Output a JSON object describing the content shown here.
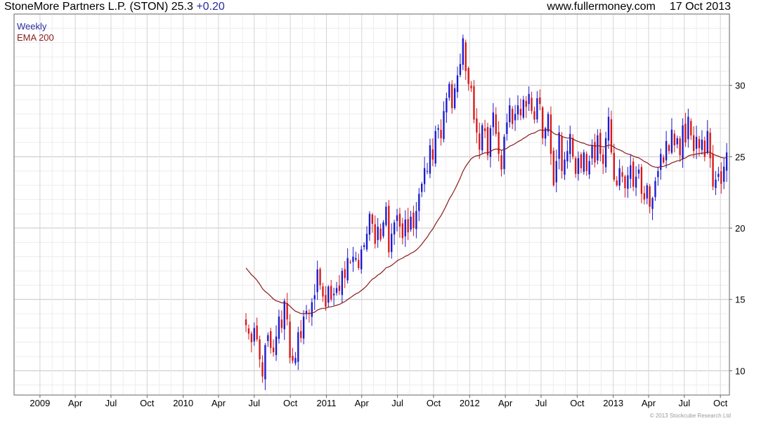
{
  "header": {
    "title": "StoneMore Partners L.P. (STON) 25.3",
    "change": "+0.20",
    "site": "www.fullermoney.com",
    "date": "17 Oct 2013"
  },
  "legend": {
    "period": "Weekly",
    "indicator": "EMA 200"
  },
  "copyright": "© 2013 Stockcube Research Ltd",
  "colors": {
    "up": "#1a1ad0",
    "down": "#d81818",
    "ema": "#8b1a1a",
    "grid": "#d8d8d8",
    "frame": "#666666"
  },
  "chart_data": {
    "type": "candlestick",
    "frequency": "weekly",
    "ylim": [
      8.3,
      35.0
    ],
    "yticks": [
      10,
      15,
      20,
      25,
      30
    ],
    "xticks": [
      {
        "label": "2009",
        "date": "2009-01-01"
      },
      {
        "label": "Apr",
        "date": "2009-04-01"
      },
      {
        "label": "Jul",
        "date": "2009-07-01"
      },
      {
        "label": "Oct",
        "date": "2009-10-01"
      },
      {
        "label": "2010",
        "date": "2010-01-01"
      },
      {
        "label": "Apr",
        "date": "2010-04-01"
      },
      {
        "label": "Jul",
        "date": "2010-07-01"
      },
      {
        "label": "Oct",
        "date": "2010-10-01"
      },
      {
        "label": "2011",
        "date": "2011-01-01"
      },
      {
        "label": "Apr",
        "date": "2011-04-01"
      },
      {
        "label": "Jul",
        "date": "2011-07-01"
      },
      {
        "label": "Oct",
        "date": "2011-10-01"
      },
      {
        "label": "2012",
        "date": "2012-01-01"
      },
      {
        "label": "Apr",
        "date": "2012-04-01"
      },
      {
        "label": "Jul",
        "date": "2012-07-01"
      },
      {
        "label": "Oct",
        "date": "2012-10-01"
      },
      {
        "label": "2013",
        "date": "2013-01-01"
      },
      {
        "label": "Apr",
        "date": "2013-04-01"
      },
      {
        "label": "Jul",
        "date": "2013-07-01"
      },
      {
        "label": "Oct",
        "date": "2013-10-01"
      }
    ],
    "x_range": [
      "2008-10-27",
      "2013-10-24"
    ],
    "close_weekly": [
      13.2,
      12.6,
      12.0,
      13.0,
      12.2,
      10.8,
      9.6,
      11.8,
      12.5,
      11.6,
      11.3,
      12.4,
      13.8,
      13.0,
      14.9,
      13.6,
      10.9,
      10.7,
      10.9,
      12.7,
      12.3,
      13.8,
      14.2,
      14.0,
      14.8,
      15.3,
      17.1,
      16.0,
      15.2,
      14.5,
      15.9,
      15.0,
      15.4,
      15.8,
      15.6,
      17.0,
      16.5,
      17.9,
      17.6,
      18.0,
      17.9,
      17.2,
      18.5,
      18.8,
      19.6,
      21.0,
      20.3,
      18.9,
      20.1,
      19.2,
      20.4,
      21.5,
      18.3,
      19.6,
      20.4,
      20.9,
      20.1,
      19.3,
      20.6,
      19.7,
      20.8,
      20.0,
      21.2,
      22.4,
      23.1,
      24.2,
      24.0,
      25.8,
      24.8,
      26.8,
      27.0,
      26.3,
      28.2,
      29.1,
      30.1,
      28.4,
      29.8,
      30.7,
      31.5,
      33.3,
      31.0,
      30.1,
      29.8,
      27.6,
      26.7,
      25.5,
      27.2,
      26.8,
      25.1,
      27.0,
      28.1,
      26.6,
      25.2,
      24.1,
      26.4,
      27.4,
      28.6,
      27.3,
      28.0,
      28.6,
      27.9,
      29.0,
      28.5,
      29.4,
      28.2,
      27.6,
      29.1,
      28.7,
      26.3,
      27.0,
      28.0,
      25.2,
      23.0,
      24.7,
      26.7,
      24.0,
      24.8,
      25.4,
      26.6,
      25.0,
      23.8,
      24.9,
      24.2,
      25.3,
      24.0,
      24.7,
      25.8,
      24.6,
      26.5,
      25.2,
      24.5,
      26.3,
      27.8,
      25.3,
      23.4,
      23.0,
      24.2,
      23.6,
      22.8,
      23.7,
      24.4,
      22.9,
      23.6,
      24.1,
      22.4,
      22.0,
      23.0,
      21.5,
      22.1,
      23.3,
      24.0,
      25.2,
      24.6,
      26.1,
      25.4,
      26.9,
      25.8,
      26.3,
      25.1,
      27.2,
      26.0,
      27.8,
      26.5,
      25.4,
      26.4,
      25.6,
      26.2,
      25.0,
      26.8,
      24.9,
      22.9,
      23.4,
      23.8,
      23.1,
      24.3,
      25.3
    ]
  }
}
